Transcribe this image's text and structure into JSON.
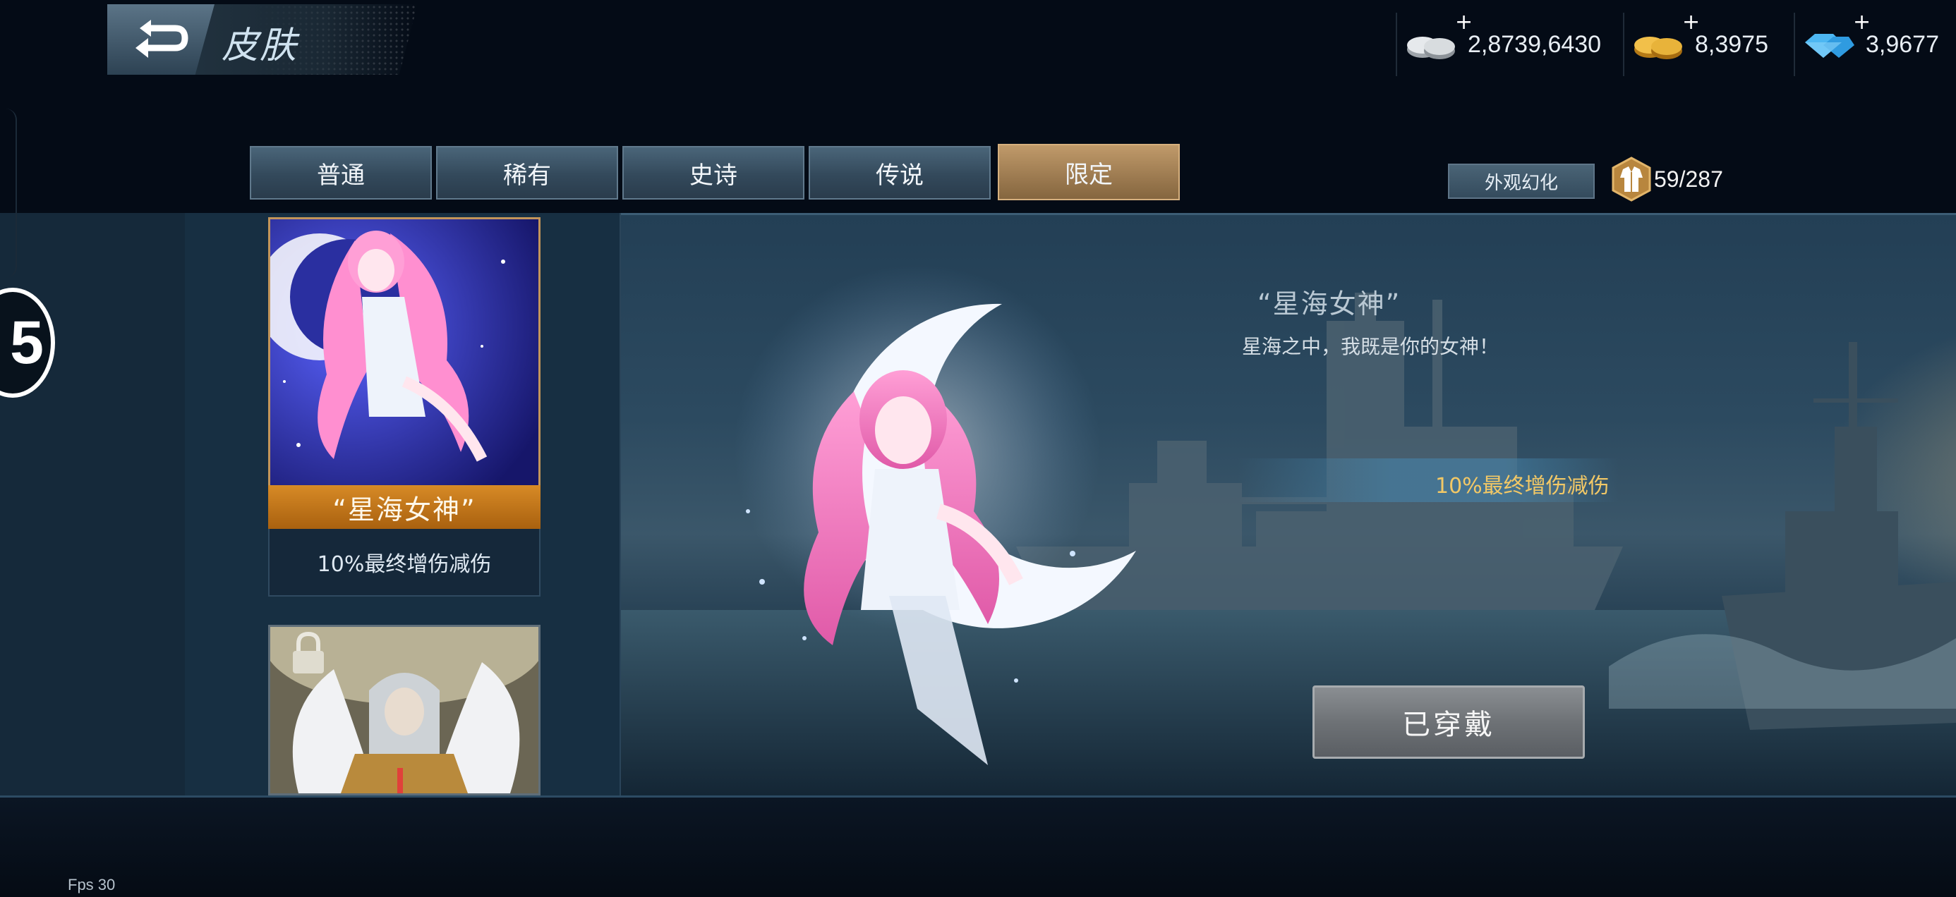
{
  "header": {
    "title": "皮肤",
    "back_icon": "return-arrow-icon"
  },
  "currencies": [
    {
      "name": "silver-coins",
      "icon": "silver-coin-stack-icon",
      "value": "2,8739,6430",
      "plus": "+"
    },
    {
      "name": "gold-coins",
      "icon": "gold-coin-stack-icon",
      "value": "8,3975",
      "plus": "+"
    },
    {
      "name": "diamonds",
      "icon": "blue-diamond-icon",
      "value": "3,9677",
      "plus": "+"
    }
  ],
  "tabs": [
    {
      "label": "普通",
      "active": false
    },
    {
      "label": "稀有",
      "active": false
    },
    {
      "label": "史诗",
      "active": false
    },
    {
      "label": "传说",
      "active": false
    },
    {
      "label": "限定",
      "active": true
    }
  ],
  "appearance_button": "外观幻化",
  "collection": {
    "count": "59/287",
    "icon": "outfit-icon"
  },
  "skins": [
    {
      "name": "“星海女神”",
      "desc": "10%最终增伤减伤",
      "selected": true
    },
    {
      "locked": true,
      "lock_icon": "lock-icon"
    }
  ],
  "detail": {
    "title": "“星海女神”",
    "quote": "星海之中，我既是你的女神！",
    "attribute": "10%最终增伤减伤",
    "equip_button": "已穿戴"
  },
  "side_badge": "5",
  "fps": "Fps 30",
  "colors": {
    "tab_active": "#a8845a",
    "tab_normal": "#3a5266",
    "attribute_text": "#f2c866",
    "card_name_bar": "#c47a1e"
  }
}
